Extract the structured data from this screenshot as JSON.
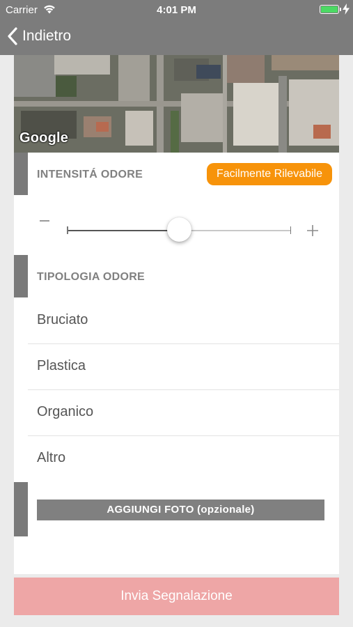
{
  "status_bar": {
    "carrier": "Carrier",
    "time": "4:01 PM",
    "battery_level": 1.0,
    "battery_color": "#4cd964"
  },
  "nav": {
    "back_label": "Indietro",
    "back_icon": "chevron-left-icon"
  },
  "map": {
    "attribution": "Google"
  },
  "intensity": {
    "label": "INTENSITÁ ODORE",
    "badge": "Facilmente Rilevabile",
    "badge_color": "#f7930a",
    "slider_value": 0.5,
    "minus_icon": "minus-icon",
    "plus_icon": "plus-icon"
  },
  "odor_type": {
    "label": "TIPOLOGIA ODORE",
    "options": [
      "Bruciato",
      "Plastica",
      "Organico",
      "Altro"
    ]
  },
  "photo": {
    "button_label": "AGGIUNGI FOTO (opzionale)"
  },
  "submit": {
    "label": "Invia Segnalazione",
    "color": "#eea6a6"
  },
  "colors": {
    "header": "#7c7c7c",
    "accent_bar": "#7a7a7a"
  }
}
